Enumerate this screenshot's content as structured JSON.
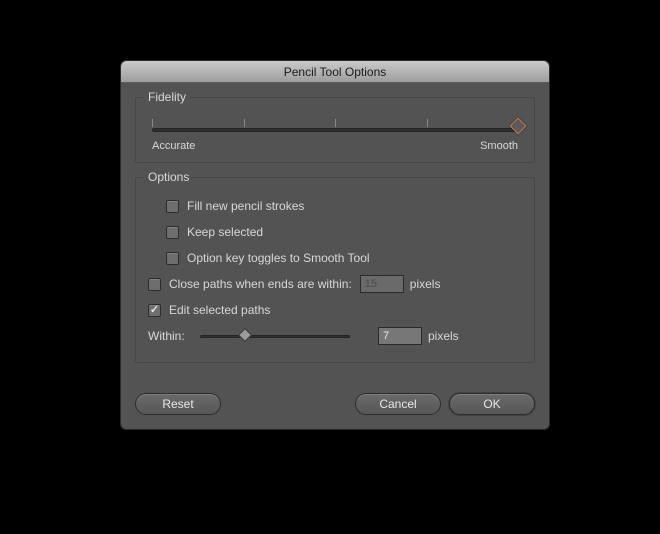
{
  "dialog": {
    "title": "Pencil Tool Options"
  },
  "fidelity": {
    "legend": "Fidelity",
    "left_label": "Accurate",
    "right_label": "Smooth",
    "position_percent": 100,
    "ticks": [
      0,
      25,
      50,
      75,
      100
    ]
  },
  "options": {
    "legend": "Options",
    "fill_new": {
      "label": "Fill new pencil strokes",
      "checked": false
    },
    "keep_selected": {
      "label": "Keep selected",
      "checked": false
    },
    "option_key": {
      "label": "Option key toggles to Smooth Tool",
      "checked": false
    },
    "close_paths": {
      "label": "Close paths when ends are within:",
      "checked": false,
      "value": "15",
      "unit": "pixels"
    },
    "edit_paths": {
      "label": "Edit selected paths",
      "checked": true
    },
    "within": {
      "label": "Within:",
      "value": "7",
      "unit": "pixels",
      "slider_percent": 30
    }
  },
  "buttons": {
    "reset": "Reset",
    "cancel": "Cancel",
    "ok": "OK"
  }
}
